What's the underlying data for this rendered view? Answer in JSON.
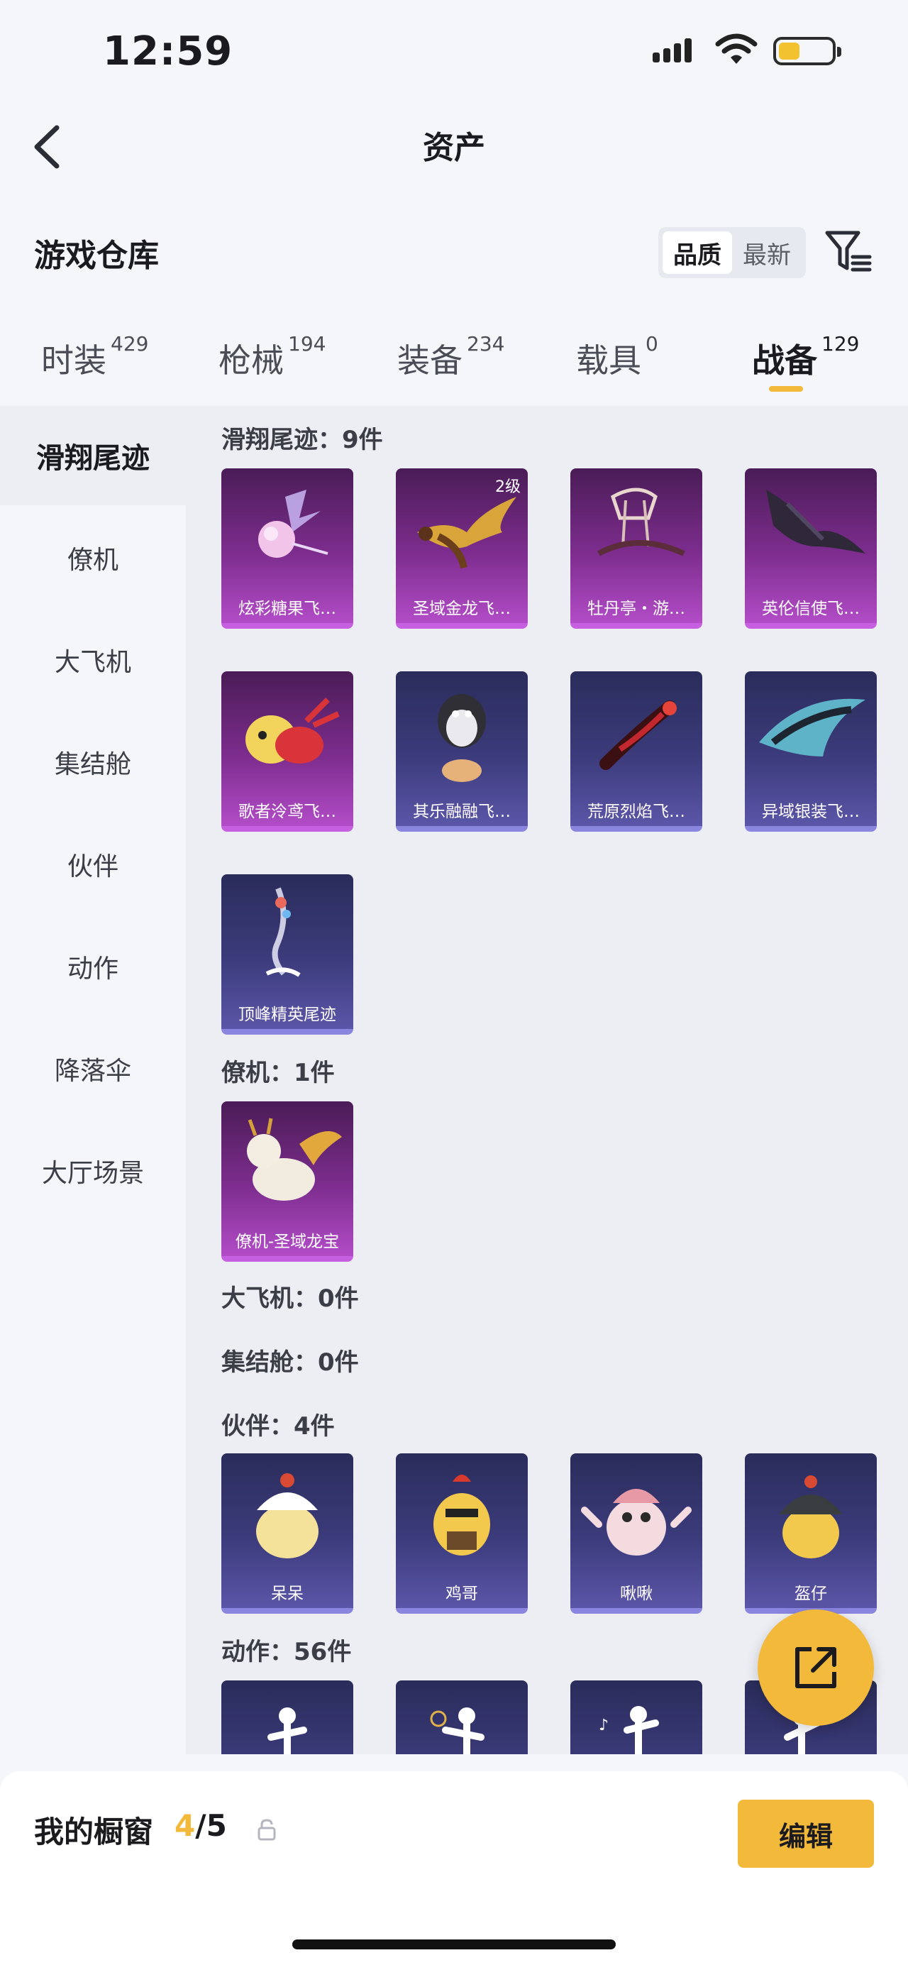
{
  "status_bar": {
    "time": "12:59",
    "battery_level": 0.4,
    "battery_color": "#f2c230"
  },
  "header": {
    "title": "资产",
    "back_icon": "chevron-left-icon"
  },
  "warehouse": {
    "title": "游戏仓库",
    "sort_options": [
      "品质",
      "最新"
    ],
    "sort_selected": "品质",
    "filter_icon": "filter-icon"
  },
  "tabs": [
    {
      "label": "时装",
      "count": "429"
    },
    {
      "label": "枪械",
      "count": "194"
    },
    {
      "label": "装备",
      "count": "234"
    },
    {
      "label": "载具",
      "count": "0"
    },
    {
      "label": "战备",
      "count": "129",
      "active": true
    }
  ],
  "sidebar": {
    "items": [
      "滑翔尾迹",
      "僚机",
      "大飞机",
      "集结舱",
      "伙伴",
      "动作",
      "降落伞",
      "大厅场景"
    ],
    "active": "滑翔尾迹"
  },
  "groups": {
    "glide": {
      "header": "滑翔尾迹：9件",
      "items": [
        {
          "name": "炫彩糖果飞…",
          "rarity": "purple"
        },
        {
          "name": "圣域金龙飞…",
          "rarity": "purple",
          "level": "2级"
        },
        {
          "name": "牡丹亭・游…",
          "rarity": "purple"
        },
        {
          "name": "英伦信使飞…",
          "rarity": "purple"
        },
        {
          "name": "歌者泠鸢飞…",
          "rarity": "purple"
        },
        {
          "name": "其乐融融飞…",
          "rarity": "blue"
        },
        {
          "name": "荒原烈焰飞…",
          "rarity": "blue"
        },
        {
          "name": "异域银装飞…",
          "rarity": "blue"
        },
        {
          "name": "顶峰精英尾迹",
          "rarity": "blue"
        }
      ]
    },
    "wingman": {
      "header": "僚机：1件",
      "items": [
        {
          "name": "僚机-圣域龙宝",
          "rarity": "purple"
        }
      ]
    },
    "plane": {
      "header": "大飞机：0件"
    },
    "pod": {
      "header": "集结舱：0件"
    },
    "partner": {
      "header": "伙伴：4件",
      "items": [
        {
          "name": "呆呆",
          "rarity": "blue"
        },
        {
          "name": "鸡哥",
          "rarity": "blue"
        },
        {
          "name": "啾啾",
          "rarity": "blue"
        },
        {
          "name": "盔仔",
          "rarity": "blue"
        }
      ]
    },
    "emote": {
      "header": "动作：56件"
    }
  },
  "share_icon": "share-icon",
  "showcase": {
    "label": "我的橱窗",
    "current": "4",
    "total": "/5",
    "lock_icon": "lock-icon",
    "edit_label": "编辑"
  },
  "colors": {
    "accent": "#f2b93a",
    "purple_card": "#7d2d8e",
    "blue_card": "#3c3b7c"
  }
}
